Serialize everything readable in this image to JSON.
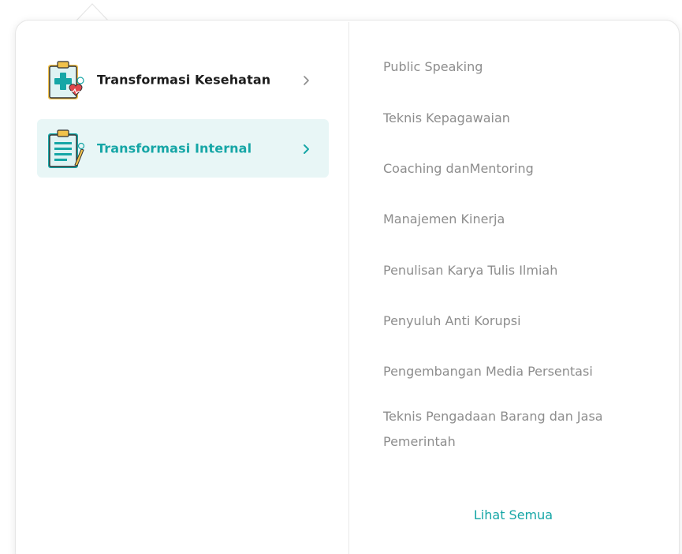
{
  "categories": [
    {
      "label": "Transformasi Kesehatan",
      "icon": "clipboard-health-icon",
      "active": false
    },
    {
      "label": "Transformasi Internal",
      "icon": "clipboard-document-icon",
      "active": true
    }
  ],
  "subitems": [
    "Public Speaking",
    "Teknis Kepagawaian",
    "Coaching danMentoring",
    "Manajemen Kinerja",
    "Penulisan Karya Tulis Ilmiah",
    "Penyuluh Anti Korupsi",
    "Pengembangan Media Persentasi",
    "Teknis Pengadaan Barang dan Jasa Pemerintah"
  ],
  "see_all": "Lihat Semua",
  "colors": {
    "accent": "#16a6a6",
    "active_bg": "#e8f6f6",
    "muted_text": "#8d8d8d",
    "primary_text": "#1c1c1c"
  }
}
